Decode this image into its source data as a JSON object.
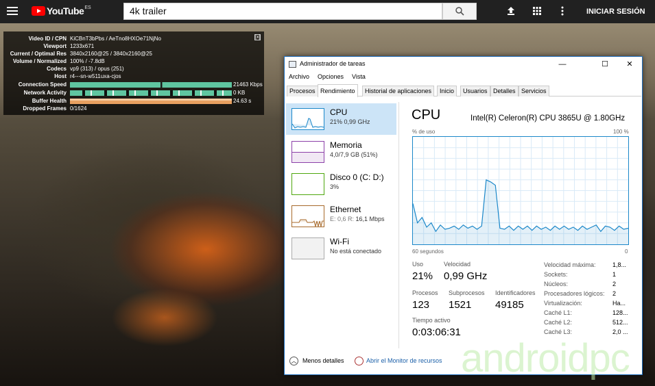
{
  "youtube": {
    "logo_text": "YouTube",
    "region": "ES",
    "search_value": "4k trailer",
    "signin_label": "INICIAR SESIÓN"
  },
  "nerds": {
    "close_label": "[x]",
    "rows": [
      {
        "label": "Video ID / CPN",
        "value": "KiCBnT3bPbs / AeTno8HXOe71NjNo"
      },
      {
        "label": "Viewport",
        "value": "1233x671"
      },
      {
        "label": "Current / Optimal Res",
        "value": "3840x2160@25 / 3840x2160@25"
      },
      {
        "label": "Volume / Normalized",
        "value": "100% / -7.8dB"
      },
      {
        "label": "Codecs",
        "value": "vp9 (313) / opus (251)"
      },
      {
        "label": "Host",
        "value": "r4---sn-w511uxa-cjos"
      },
      {
        "label": "Connection Speed",
        "value": "21463 Kbps"
      },
      {
        "label": "Network Activity",
        "value": "0 KB"
      },
      {
        "label": "Buffer Health",
        "value": "24.63 s"
      },
      {
        "label": "Dropped Frames",
        "value": "0/1624"
      }
    ]
  },
  "taskmanager": {
    "title": "Administrador de tareas",
    "menu": [
      "Archivo",
      "Opciones",
      "Vista"
    ],
    "tabs": [
      "Procesos",
      "Rendimiento",
      "Historial de aplicaciones",
      "Inicio",
      "Usuarios",
      "Detalles",
      "Servicios"
    ],
    "active_tab": "Rendimiento",
    "sidebar": [
      {
        "name": "CPU",
        "sub": "21% 0,99 GHz",
        "color": "#1a87c9"
      },
      {
        "name": "Memoria",
        "sub": "4,0/7,9 GB (51%)",
        "color": "#8b3fa8"
      },
      {
        "name": "Disco 0 (C: D:)",
        "sub": "3%",
        "color": "#4da60c"
      },
      {
        "name": "Ethernet",
        "sub_prefix": "E: 0,6 R:",
        "sub_value": "16,1 Mbps",
        "color": "#a7692a"
      },
      {
        "name": "Wi-Fi",
        "sub": "No está conectado",
        "color": "#aaaaaa"
      }
    ],
    "main": {
      "heading": "CPU",
      "model": "Intel(R) Celeron(R) CPU 3865U @ 1.80GHz",
      "y_label": "% de uso",
      "y_max": "100 %",
      "x_left": "60 segundos",
      "x_right": "0",
      "usage_series": [
        38,
        20,
        25,
        16,
        20,
        12,
        18,
        14,
        15,
        17,
        14,
        18,
        15,
        17,
        14,
        17,
        60,
        58,
        55,
        15,
        14,
        17,
        13,
        17,
        14,
        17,
        13,
        17,
        14,
        16,
        13,
        17,
        14,
        17,
        14,
        16,
        13,
        17,
        14,
        16,
        18,
        12,
        17,
        16,
        13,
        17,
        14,
        15
      ],
      "stats": {
        "uso_label": "Uso",
        "uso_value": "21%",
        "velocidad_label": "Velocidad",
        "velocidad_value": "0,99 GHz",
        "procesos_label": "Procesos",
        "procesos_value": "123",
        "subprocesos_label": "Subprocesos",
        "subprocesos_value": "1521",
        "identificadores_label": "Identificadores",
        "identificadores_value": "49185",
        "tiempo_label": "Tiempo activo",
        "tiempo_value": "0:03:06:31"
      },
      "specs": [
        {
          "label": "Velocidad máxima:",
          "value": "1,8..."
        },
        {
          "label": "Sockets:",
          "value": "1"
        },
        {
          "label": "Núcleos:",
          "value": "2"
        },
        {
          "label": "Procesadores lógicos:",
          "value": "2"
        },
        {
          "label": "Virtualización:",
          "value": "Ha..."
        },
        {
          "label": "Caché L1:",
          "value": "128..."
        },
        {
          "label": "Caché L2:",
          "value": "512..."
        },
        {
          "label": "Caché L3:",
          "value": "2,0 ..."
        }
      ]
    },
    "footer": {
      "less_details": "Menos detalles",
      "resource_monitor": "Abrir el Monitor de recursos"
    }
  },
  "watermark": "androidpc"
}
